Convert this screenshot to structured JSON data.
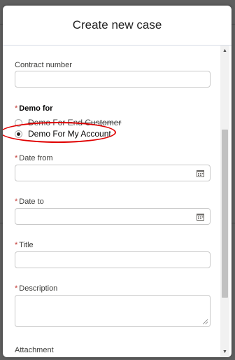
{
  "modal": {
    "title": "Create new case"
  },
  "form": {
    "contract_number": {
      "label": "Contract number",
      "value": ""
    },
    "demo_for": {
      "required_mark": "*",
      "label": "Demo for",
      "options": [
        {
          "label": "Demo For End Customer",
          "checked": false
        },
        {
          "label": "Demo For My Account",
          "checked": true
        }
      ]
    },
    "date_from": {
      "required_mark": "*",
      "label": "Date from",
      "icon": "calendar-icon"
    },
    "date_to": {
      "required_mark": "*",
      "label": "Date to",
      "icon": "calendar-icon"
    },
    "title": {
      "required_mark": "*",
      "label": "Title"
    },
    "description": {
      "required_mark": "*",
      "label": "Description"
    },
    "attachment": {
      "label": "Attachment"
    }
  },
  "annotation": {
    "color": "#e00000",
    "highlights": "Demo For My Account"
  },
  "colors": {
    "required": "#c23934",
    "border": "#c9c9c9",
    "backdrop": "#5f5f5f"
  }
}
